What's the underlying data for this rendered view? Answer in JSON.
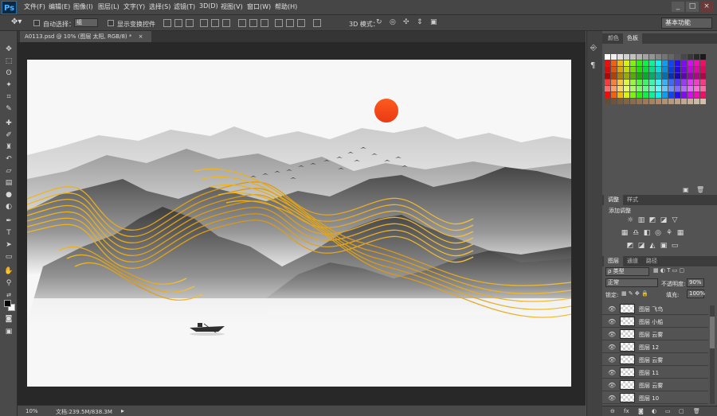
{
  "app": {
    "logo": "Ps"
  },
  "menu": [
    "文件(F)",
    "编辑(E)",
    "图像(I)",
    "图层(L)",
    "文字(Y)",
    "选择(S)",
    "滤镜(T)",
    "3D(D)",
    "视图(V)",
    "窗口(W)",
    "帮助(H)"
  ],
  "window_controls": [
    "_",
    "□",
    "×"
  ],
  "options": {
    "auto_select_label": "自动选择：",
    "auto_select_value": "组",
    "show_transform_label": "显示变换控件",
    "mode_3d_label": "3D 模式："
  },
  "workspace": "基本功能",
  "document_tab": {
    "title": "A0113.psd @ 10% (图层 太阳, RGB/8) *",
    "close": "×"
  },
  "status": {
    "zoom": "10%",
    "doc_info": "文档:239.5M/838.3M"
  },
  "color_panel": {
    "tabs": [
      "颜色",
      "色板"
    ],
    "active": "色板"
  },
  "adjust_panel": {
    "tabs": [
      "调整",
      "样式"
    ],
    "title": "添加调整"
  },
  "layers_panel": {
    "tabs": [
      "图层",
      "通道",
      "路径"
    ],
    "filter_kind": "类型",
    "blend_mode": "正常",
    "opacity_label": "不透明度:",
    "opacity": "90%",
    "lock_label": "锁定:",
    "fill_label": "填充:",
    "fill": "100%",
    "layers": [
      {
        "name": "图层 飞鸟"
      },
      {
        "name": "图层 小船"
      },
      {
        "name": "图层 云雾"
      },
      {
        "name": "图层 12"
      },
      {
        "name": "图层 云雾"
      },
      {
        "name": "图层 11"
      },
      {
        "name": "图层 云雾"
      },
      {
        "name": "图层 10"
      }
    ],
    "footer_icons": [
      "⊖",
      "fx",
      "◙",
      "◐",
      "▭",
      "▢",
      "🗑"
    ]
  },
  "colors": {
    "sun": "#ff4a1c",
    "gold": "#e2a21a",
    "ink_dark": "#3c3c3c"
  }
}
